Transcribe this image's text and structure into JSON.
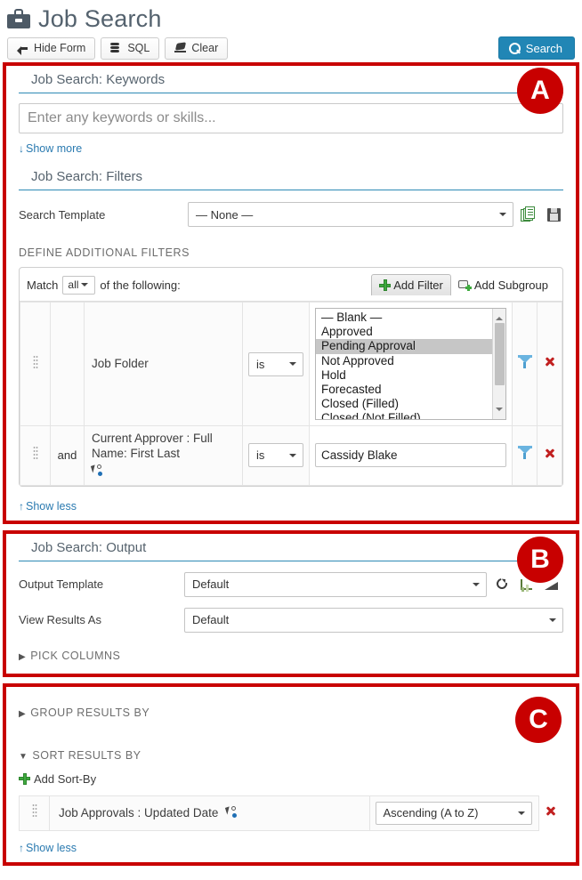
{
  "header": {
    "icon": "briefcase-icon",
    "title": "Job Search"
  },
  "toolbar": {
    "hide_form_label": "Hide Form",
    "hide_form_icon": "arrow-left-icon",
    "sql_label": "SQL",
    "sql_icon": "database-icon",
    "clear_label": "Clear",
    "clear_icon": "eraser-icon",
    "search_label": "Search",
    "search_icon": "magnifier-icon"
  },
  "annotations": {
    "a": "A",
    "b": "B",
    "c": "C",
    "color": "#c80000"
  },
  "keywords": {
    "title": "Job Search: Keywords",
    "input_placeholder": "Enter any keywords or skills...",
    "input_value": "",
    "toggle_label": "Show more",
    "toggle_arrow": "↓"
  },
  "filters": {
    "title": "Job Search: Filters",
    "search_template_label": "Search Template",
    "search_template_value": "— None —",
    "copy_icon": "copy-pages-icon",
    "save_icon": "floppy-save-icon",
    "define_heading": "DEFINE ADDITIONAL FILTERS",
    "match_prefix": "Match",
    "match_value": "all",
    "match_suffix": "of the following:",
    "add_filter_label": "Add Filter",
    "add_filter_icon": "plus-icon",
    "add_subgroup_label": "Add Subgroup",
    "add_subgroup_icon": "subgroup-icon",
    "toggle_label": "Show less",
    "toggle_arrow": "↑",
    "rows": [
      {
        "conjunction": "",
        "field": "Job Folder",
        "operator": "is",
        "value_type": "listbox",
        "options": [
          "— Blank —",
          "Approved",
          "Pending Approval",
          "Not Approved",
          "Hold",
          "Forecasted",
          "Closed (Filled)",
          "Closed (Not Filled)"
        ],
        "selected": "Pending Approval",
        "funnel_icon": "funnel-icon",
        "remove_icon": "remove-x-icon"
      },
      {
        "conjunction": "and",
        "field": "Current Approver : Full Name: First Last",
        "field_icon": "cursor-select-icon",
        "operator": "is",
        "value_type": "text",
        "value": "Cassidy Blake",
        "funnel_icon": "funnel-icon",
        "remove_icon": "remove-x-icon"
      }
    ]
  },
  "output": {
    "title": "Job Search: Output",
    "output_template_label": "Output Template",
    "output_template_value": "Default",
    "refresh_icon": "refresh-icon",
    "grid_icon": "chart-grid-icon",
    "wedge_icon": "wedge-icon",
    "view_results_label": "View Results As",
    "view_results_value": "Default",
    "pick_columns_label": "PICK COLUMNS",
    "pick_columns_arrow": "▶"
  },
  "grouping": {
    "group_results_label": "GROUP RESULTS BY",
    "group_results_arrow": "▶",
    "sort_results_label": "SORT RESULTS BY",
    "sort_results_arrow": "▼",
    "add_sortby_label": "Add Sort-By",
    "add_sortby_icon": "plus-icon",
    "sort_rows": [
      {
        "field": "Job Approvals : Updated Date",
        "field_icon": "cursor-select-icon",
        "direction": "Ascending (A to Z)",
        "remove_icon": "remove-x-icon"
      }
    ],
    "toggle_label": "Show less",
    "toggle_arrow": "↑"
  }
}
